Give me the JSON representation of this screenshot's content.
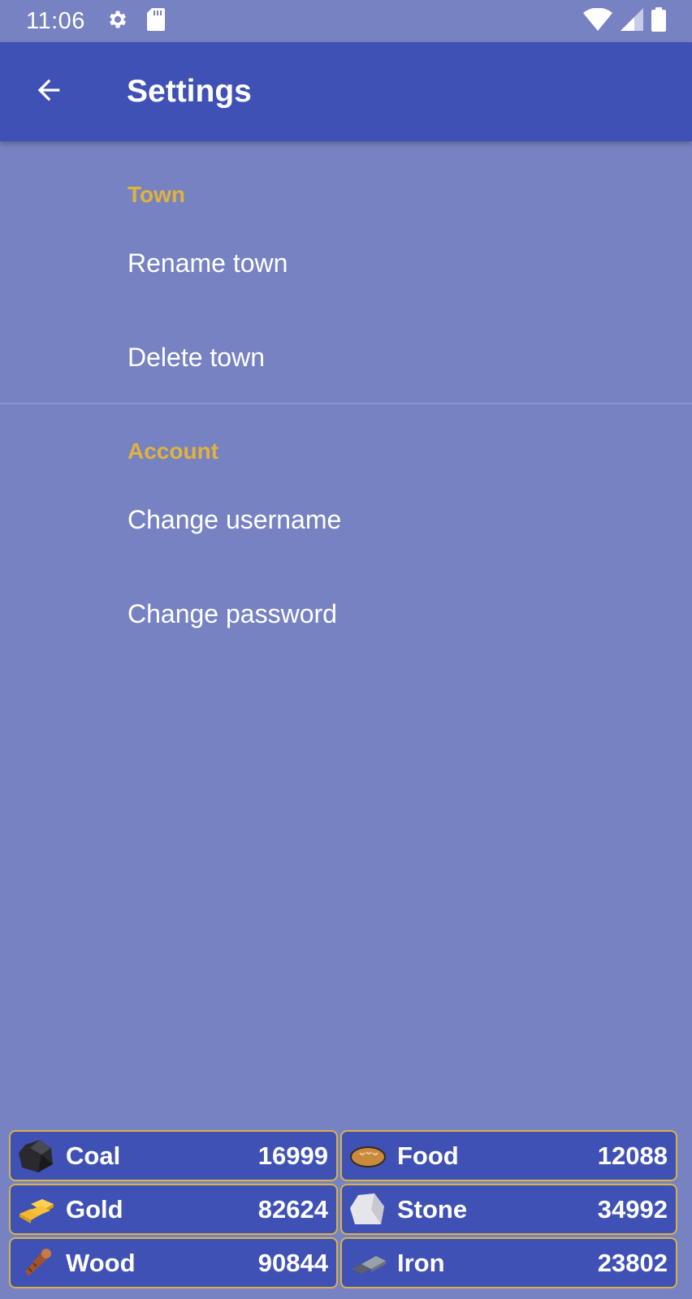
{
  "status_bar": {
    "time": "11:06",
    "icons": [
      "gear-icon",
      "sd-card-icon",
      "wifi-icon",
      "signal-icon",
      "battery-icon"
    ]
  },
  "app_bar": {
    "title": "Settings",
    "back_icon": "arrow-back-icon"
  },
  "settings": {
    "town": {
      "header": "Town",
      "items": [
        "Rename town",
        "Delete town"
      ]
    },
    "account": {
      "header": "Account",
      "items": [
        "Change username",
        "Change password"
      ]
    }
  },
  "resources": [
    {
      "name": "Coal",
      "value": "16999",
      "icon": "coal-icon"
    },
    {
      "name": "Food",
      "value": "12088",
      "icon": "bread-icon"
    },
    {
      "name": "Gold",
      "value": "82624",
      "icon": "gold-bars-icon"
    },
    {
      "name": "Stone",
      "value": "34992",
      "icon": "stone-icon"
    },
    {
      "name": "Wood",
      "value": "90844",
      "icon": "wood-log-icon"
    },
    {
      "name": "Iron",
      "value": "23802",
      "icon": "iron-ingot-icon"
    }
  ],
  "colors": {
    "background": "#7782c2",
    "app_bar": "#3f51b5",
    "accent": "#e0b33a",
    "tile_border": "#d8b24a"
  }
}
